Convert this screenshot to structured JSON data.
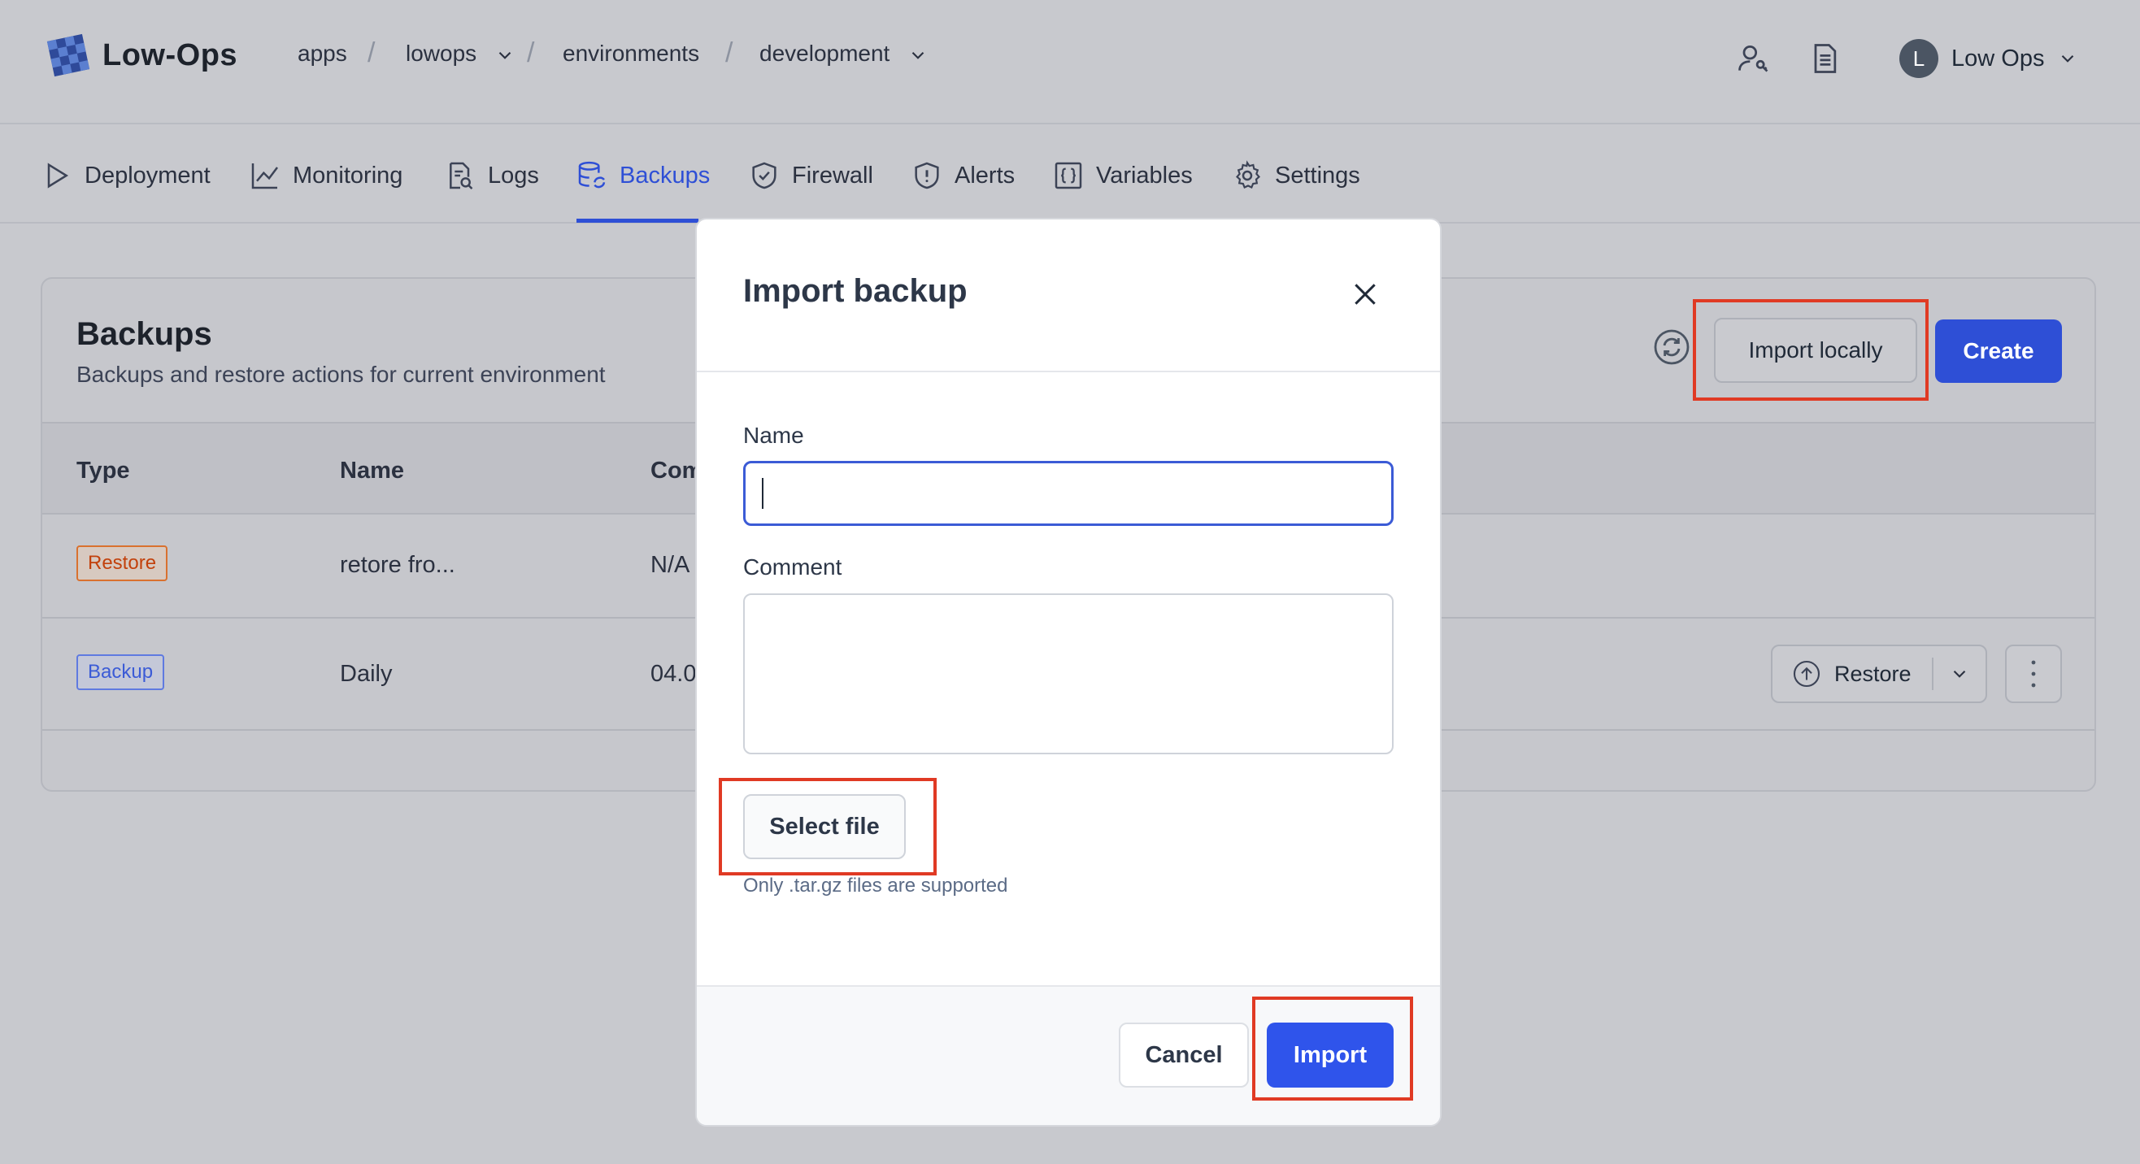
{
  "app": {
    "name": "Low-Ops"
  },
  "breadcrumb": [
    "apps",
    "lowops",
    "environments",
    "development"
  ],
  "user": {
    "initial": "L",
    "name": "Low Ops"
  },
  "tabs": [
    {
      "label": "Deployment",
      "icon": "play-icon"
    },
    {
      "label": "Monitoring",
      "icon": "chart-line-icon"
    },
    {
      "label": "Logs",
      "icon": "document-search-icon"
    },
    {
      "label": "Backups",
      "icon": "database-sync-icon",
      "active": true
    },
    {
      "label": "Firewall",
      "icon": "shield-check-icon"
    },
    {
      "label": "Alerts",
      "icon": "shield-alert-icon"
    },
    {
      "label": "Variables",
      "icon": "braces-icon"
    },
    {
      "label": "Settings",
      "icon": "gear-icon"
    }
  ],
  "backups": {
    "title": "Backups",
    "subtitle": "Backups and restore actions for current environment",
    "import_locally_label": "Import locally",
    "create_label": "Create",
    "columns": [
      "Type",
      "Name",
      "Com"
    ],
    "rows": [
      {
        "type": "Restore",
        "name": "retore fro...",
        "comment": "N/A"
      },
      {
        "type": "Backup",
        "name": "Daily",
        "comment": "04.0",
        "action": "Restore"
      }
    ]
  },
  "modal": {
    "title": "Import backup",
    "name_label": "Name",
    "name_value": "",
    "comment_label": "Comment",
    "comment_value": "",
    "select_file_label": "Select file",
    "hint": "Only .tar.gz files are supported",
    "cancel_label": "Cancel",
    "import_label": "Import"
  },
  "colors": {
    "accent": "#2e4fd6",
    "import_button": "#2f54eb",
    "highlight": "#e03a24",
    "restore_badge": "#d9712f",
    "backup_badge": "#5f7ae0"
  }
}
